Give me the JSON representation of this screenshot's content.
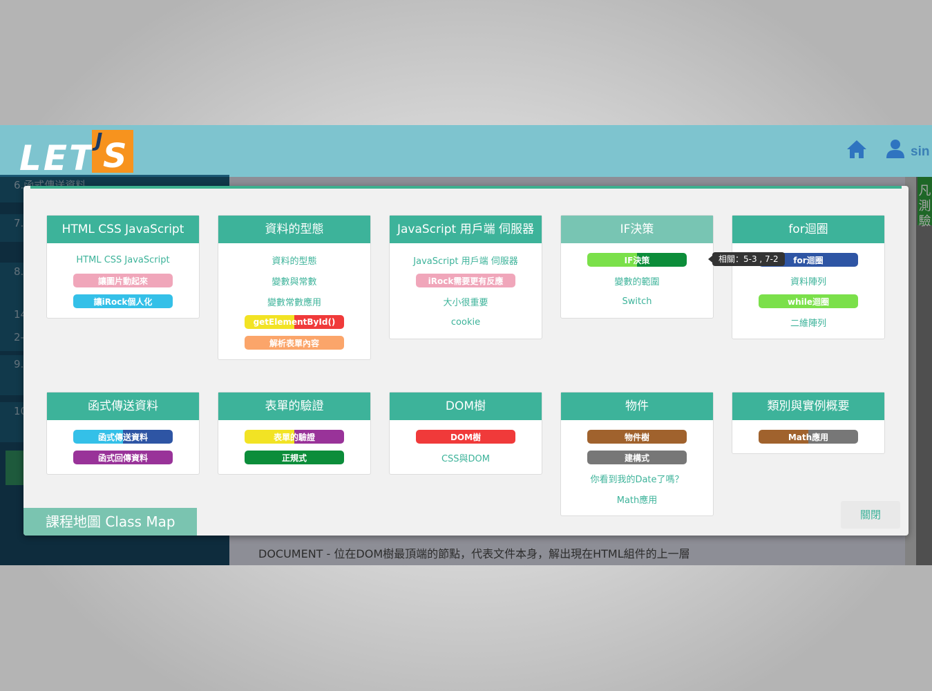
{
  "header": {
    "logo_text": "LET",
    "logo_j": "J",
    "logo_s": "S",
    "user_name": "sin"
  },
  "background": {
    "items": [
      "6.函式傳送資料",
      "7.",
      "8.",
      "14",
      "2-",
      "9.",
      "10"
    ],
    "doc_line": "DOCUMENT - 位在DOM樹最頂端的節點，代表文件本身，解出現在HTML組件的上一層",
    "green_label": "凡\n測\n驗"
  },
  "tooltip": "相關：5-3 , 7-2",
  "class_map_label": "課程地圖 Class Map",
  "close_label": "關閉",
  "cards": [
    {
      "title": "HTML CSS JavaScript",
      "items": [
        {
          "text": "HTML CSS JavaScript",
          "kind": "link"
        },
        {
          "text": "讓圖片動起來",
          "kind": "pill",
          "colors": [
            "#f0a6ba"
          ]
        },
        {
          "text": "讓iRock個人化",
          "kind": "pill",
          "colors": [
            "#34c0e8"
          ]
        }
      ]
    },
    {
      "title": "資料的型態",
      "items": [
        {
          "text": "資料的型態",
          "kind": "link"
        },
        {
          "text": "變數與常數",
          "kind": "link"
        },
        {
          "text": "變數常數應用",
          "kind": "link"
        },
        {
          "text": "getElementById()",
          "kind": "pill",
          "colors": [
            "#f2e324",
            "#f03a3a"
          ]
        },
        {
          "text": "解析表單內容",
          "kind": "pill",
          "colors": [
            "#fba56a"
          ]
        }
      ]
    },
    {
      "title": "JavaScript 用戶端 伺服器",
      "items": [
        {
          "text": "JavaScript 用戶端 伺服器",
          "kind": "link"
        },
        {
          "text": "iRock需要更有反應",
          "kind": "pill",
          "colors": [
            "#f0a6ba"
          ]
        },
        {
          "text": "大小很重要",
          "kind": "link"
        },
        {
          "text": "cookie",
          "kind": "link"
        }
      ]
    },
    {
      "title": "IF決策",
      "light": true,
      "items": [
        {
          "text": "IF決策",
          "kind": "pill",
          "colors": [
            "#7be04a",
            "#0c8d3a"
          ]
        },
        {
          "text": "變數的範圍",
          "kind": "link"
        },
        {
          "text": "Switch",
          "kind": "link"
        }
      ]
    },
    {
      "title": "for迴圈",
      "items": [
        {
          "text": "for迴圈",
          "kind": "pill",
          "colors": [
            "#2e55a4"
          ]
        },
        {
          "text": "資料陣列",
          "kind": "link"
        },
        {
          "text": "while迴圈",
          "kind": "pill",
          "colors": [
            "#7be04a"
          ]
        },
        {
          "text": "二維陣列",
          "kind": "link"
        }
      ]
    },
    {
      "title": "函式傳送資料",
      "items": [
        {
          "text": "函式傳送資料",
          "kind": "pill",
          "colors": [
            "#34c0e8",
            "#2e55a4"
          ]
        },
        {
          "text": "函式回傳資料",
          "kind": "pill",
          "colors": [
            "#993399"
          ]
        }
      ]
    },
    {
      "title": "表單的驗證",
      "items": [
        {
          "text": "表單的驗證",
          "kind": "pill",
          "colors": [
            "#f2e324",
            "#993399"
          ]
        },
        {
          "text": "正規式",
          "kind": "pill",
          "colors": [
            "#0c8d3a"
          ]
        }
      ]
    },
    {
      "title": "DOM樹",
      "items": [
        {
          "text": "DOM樹",
          "kind": "pill",
          "colors": [
            "#f03a3a"
          ]
        },
        {
          "text": "CSS與DOM",
          "kind": "link"
        }
      ]
    },
    {
      "title": "物件",
      "items": [
        {
          "text": "物件樹",
          "kind": "pill",
          "colors": [
            "#a0622d"
          ]
        },
        {
          "text": "建構式",
          "kind": "pill",
          "colors": [
            "#777777"
          ]
        },
        {
          "text": "你看到我的Date了嗎？",
          "kind": "link"
        },
        {
          "text": "Math應用",
          "kind": "link"
        }
      ]
    },
    {
      "title": "類別與實例概要",
      "items": [
        {
          "text": "Math應用",
          "kind": "pill",
          "colors": [
            "#a0622d",
            "#777777"
          ]
        }
      ]
    }
  ]
}
